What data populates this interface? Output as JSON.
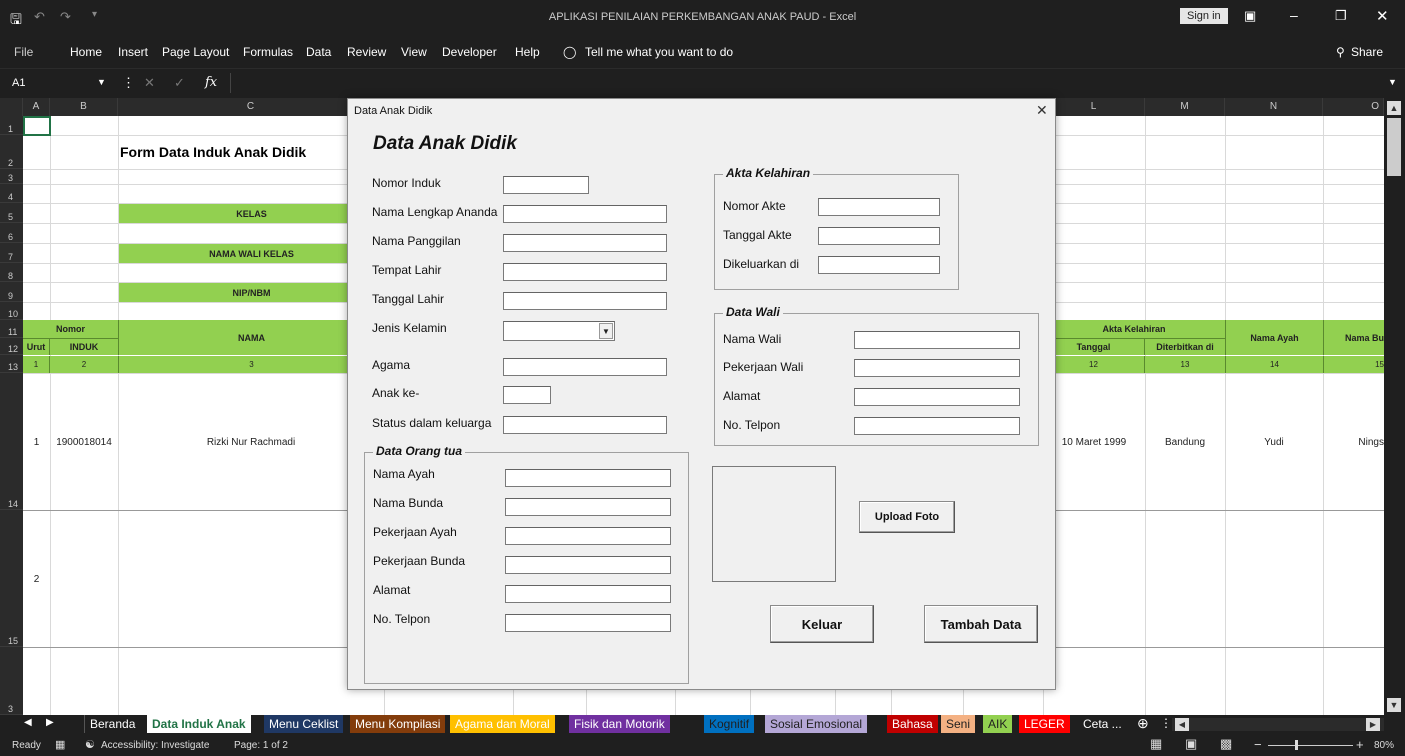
{
  "window": {
    "title": "APLIKASI PENILAIAN PERKEMBANGAN ANAK PAUD  -  Excel",
    "sign_in": "Sign in",
    "share": "Share"
  },
  "menu": [
    "File",
    "Home",
    "Insert",
    "Page Layout",
    "Formulas",
    "Data",
    "Review",
    "View",
    "Developer",
    "Help"
  ],
  "tell_me": "Tell me what you want to do",
  "formula": {
    "name_box": "A1",
    "fx": "fx"
  },
  "columns": [
    {
      "label": "A"
    },
    {
      "label": "B"
    },
    {
      "label": "C"
    },
    {
      "label": "L"
    },
    {
      "label": "M"
    },
    {
      "label": "N"
    },
    {
      "label": "O"
    }
  ],
  "rows": [
    "1",
    "2",
    "3",
    "4",
    "5",
    "6",
    "7",
    "8",
    "9",
    "10",
    "11",
    "12",
    "13",
    "14",
    "15",
    "3"
  ],
  "sheet": {
    "form_title": "Form Data Induk Anak Didik",
    "kelas": "KELAS",
    "wali_kelas": "NAMA WALI KELAS",
    "nip": "NIP/NBM",
    "h_nomor": "Nomor",
    "h_urut": "Urut",
    "h_induk": "INDUK",
    "h_nama": "NAMA",
    "h_akta": "Akta Kelahiran",
    "h_tanggal": "Tanggal",
    "h_diterbitkan": "Diterbitkan di",
    "h_ayah": "Nama Ayah",
    "h_bunda": "Nama Bu",
    "n1": "1",
    "n2": "2",
    "n3": "3",
    "n12": "12",
    "n13": "13",
    "n14": "14",
    "n15": "15",
    "r1_no": "1",
    "r1_induk": "1900018014",
    "r1_nama": "Rizki Nur Rachmadi",
    "r1_tgl": "10 Maret 1999",
    "r1_tempat": "Bandung",
    "r1_ayah": "Yudi",
    "r1_bunda": "Nings",
    "r2_no": "2"
  },
  "dialog": {
    "window_title": "Data Anak Didik",
    "heading": "Data Anak Didik",
    "fields": {
      "nomor_induk": "Nomor Induk",
      "nama_lengkap": "Nama Lengkap Ananda",
      "nama_panggilan": "Nama Panggilan",
      "tempat_lahir": "Tempat Lahir",
      "tanggal_lahir": "Tanggal Lahir",
      "jenis_kelamin": "Jenis Kelamin",
      "agama": "Agama",
      "anak_ke": "Anak ke-",
      "status": "Status dalam keluarga"
    },
    "ortu": {
      "title": "Data Orang tua",
      "nama_ayah": "Nama Ayah",
      "nama_bunda": "Nama Bunda",
      "pekerjaan_ayah": "Pekerjaan Ayah",
      "pekerjaan_bunda": "Pekerjaan Bunda",
      "alamat": "Alamat",
      "telpon": "No. Telpon"
    },
    "akta": {
      "title": "Akta Kelahiran",
      "nomor": "Nomor Akte",
      "tanggal": "Tanggal Akte",
      "dikeluarkan": "Dikeluarkan di"
    },
    "wali": {
      "title": "Data Wali",
      "nama": "Nama Wali",
      "pekerjaan": "Pekerjaan Wali",
      "alamat": "Alamat",
      "telpon": "No. Telpon"
    },
    "buttons": {
      "upload": "Upload Foto",
      "keluar": "Keluar",
      "tambah": "Tambah Data"
    }
  },
  "tabs": [
    {
      "label": "Beranda",
      "bg": "#1f1f1f",
      "fg": "#ffffff"
    },
    {
      "label": "Data Induk Anak",
      "bg": "#ffffff",
      "fg": "#217346"
    },
    {
      "label": "Menu Ceklist",
      "bg": "#1f3864",
      "fg": "#ffffff"
    },
    {
      "label": "Menu Kompilasi",
      "bg": "#833c0b",
      "fg": "#ffffff"
    },
    {
      "label": "Agama dan Moral",
      "bg": "#ffc000",
      "fg": "#ffffff"
    },
    {
      "label": "Fisik dan Motorik",
      "bg": "#7030a0",
      "fg": "#ffffff"
    },
    {
      "label": "Kognitif",
      "bg": "#0070c0",
      "fg": "#1f1f1f"
    },
    {
      "label": "Sosial Emosional",
      "bg": "#b4a7d6",
      "fg": "#1f1f1f"
    },
    {
      "label": "Bahasa",
      "bg": "#c00000",
      "fg": "#ffffff"
    },
    {
      "label": "Seni",
      "bg": "#f4b183",
      "fg": "#1f1f1f"
    },
    {
      "label": "AIK",
      "bg": "#92d050",
      "fg": "#1f1f1f"
    },
    {
      "label": "LEGER",
      "bg": "#ff0000",
      "fg": "#ffffff"
    },
    {
      "label": "Ceta ...",
      "bg": "#1f1f1f",
      "fg": "#ffffff"
    }
  ],
  "status": {
    "ready": "Ready",
    "accessibility": "Accessibility: Investigate",
    "page": "Page: 1 of 2",
    "zoom": "80%"
  }
}
